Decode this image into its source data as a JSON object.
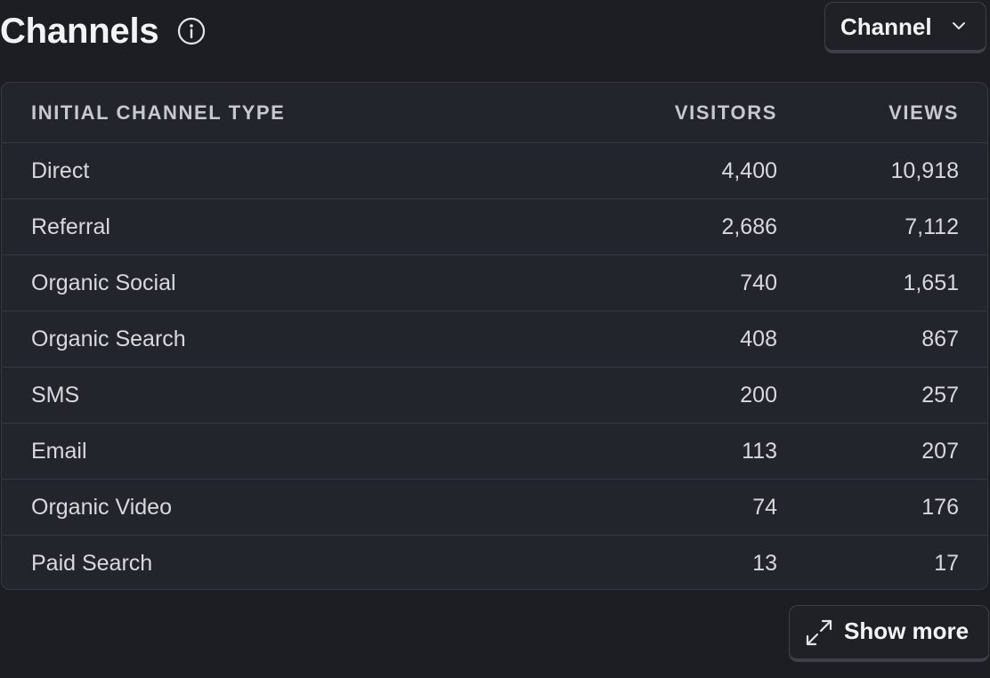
{
  "header": {
    "title": "Channels",
    "dropdown_label": "Channel"
  },
  "table": {
    "columns": [
      "INITIAL CHANNEL TYPE",
      "VISITORS",
      "VIEWS"
    ],
    "rows": [
      {
        "name": "Direct",
        "visitors": "4,400",
        "views": "10,918"
      },
      {
        "name": "Referral",
        "visitors": "2,686",
        "views": "7,112"
      },
      {
        "name": "Organic Social",
        "visitors": "740",
        "views": "1,651"
      },
      {
        "name": "Organic Search",
        "visitors": "408",
        "views": "867"
      },
      {
        "name": "SMS",
        "visitors": "200",
        "views": "257"
      },
      {
        "name": "Email",
        "visitors": "113",
        "views": "207"
      },
      {
        "name": "Organic Video",
        "visitors": "74",
        "views": "176"
      },
      {
        "name": "Paid Search",
        "visitors": "13",
        "views": "17"
      }
    ]
  },
  "footer": {
    "show_more_label": "Show more"
  },
  "icons": {
    "info": "info-icon",
    "chevron": "chevron-down-icon",
    "expand": "expand-icon"
  },
  "colors": {
    "background": "#1c1e24",
    "card": "#22252c",
    "border": "#363943",
    "text": "#d8d9dd"
  }
}
